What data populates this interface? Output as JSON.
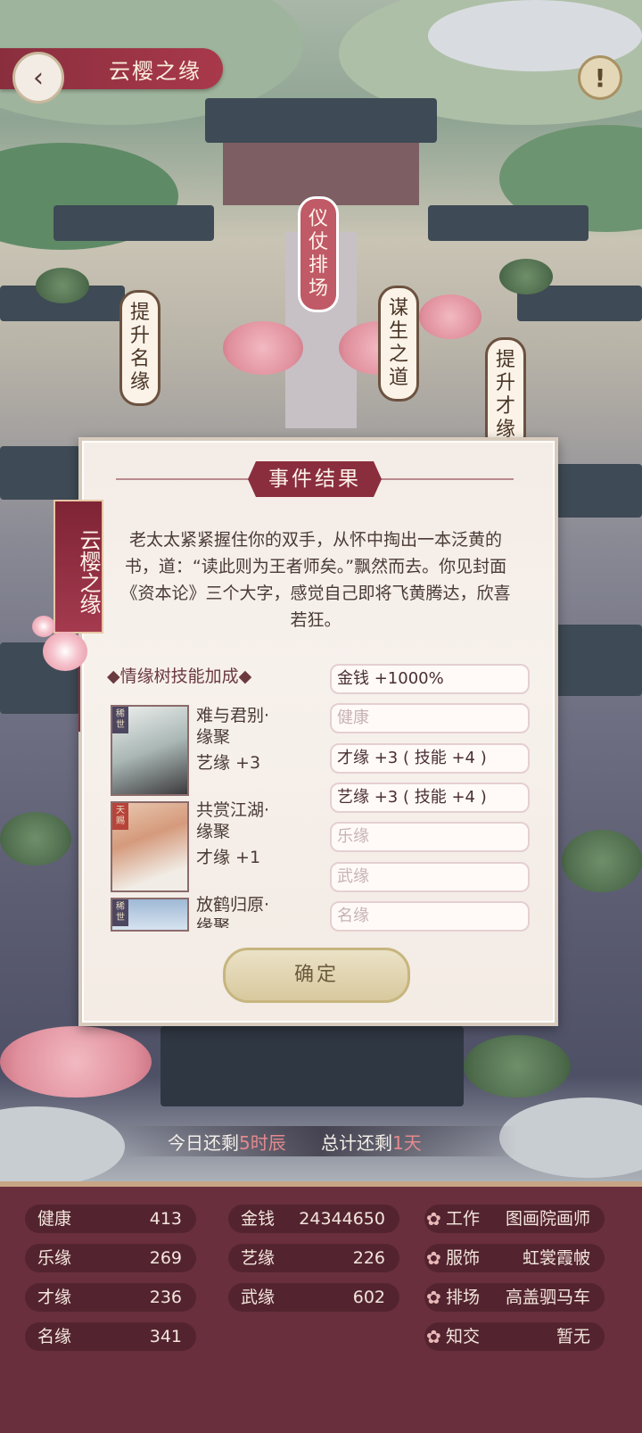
{
  "header": {
    "title": "云樱之缘",
    "back_icon": "‹",
    "info_icon": "!"
  },
  "map_labels": {
    "yizhang": "仪仗排场",
    "tisheng_mingyuan": "提升名缘",
    "mousheng": "谋生之道",
    "tisheng_caiyuan": "提升才缘"
  },
  "modal": {
    "title": "事件结果",
    "body": "老太太紧紧握住你的双手，从怀中掏出一本泛黄的书，道：“读此则为王者师矣。”飘然而去。你见封面《资本论》三个大字，感觉自己即将飞黄腾达，欣喜若狂。",
    "ribbon_text": "云樱之缘",
    "section_head": "◆情缘树技能加成◆",
    "cards": [
      {
        "tag": "稀世",
        "name_line1": "难与君别·",
        "name_line2": "缘聚",
        "bonus": "艺缘 +3"
      },
      {
        "tag": "天赐",
        "name_line1": "共赏江湖·",
        "name_line2": "缘聚",
        "bonus": "才缘 +1"
      },
      {
        "tag": "稀世",
        "name_line1": "放鹤归原·",
        "name_line2": "缘聚"
      }
    ],
    "stat_pills": [
      {
        "label": "金钱 +1000%",
        "active": true
      },
      {
        "label": "健康",
        "active": false
      },
      {
        "label": "才缘 +3 ( 技能 +4 )",
        "active": true
      },
      {
        "label": "艺缘 +3 ( 技能 +4 )",
        "active": true
      },
      {
        "label": "乐缘",
        "active": false
      },
      {
        "label": "武缘",
        "active": false
      },
      {
        "label": "名缘",
        "active": false
      }
    ],
    "confirm_label": "确定"
  },
  "time": {
    "prefix": "今日还剩",
    "hours": "5时辰",
    "total_prefix": "总计还剩",
    "days": "1天"
  },
  "stats": {
    "col1": [
      {
        "k": "健康",
        "v": "413"
      },
      {
        "k": "乐缘",
        "v": "269"
      },
      {
        "k": "才缘",
        "v": "236"
      },
      {
        "k": "名缘",
        "v": "341"
      }
    ],
    "col2": [
      {
        "k": "金钱",
        "v": "24344650"
      },
      {
        "k": "艺缘",
        "v": "226"
      },
      {
        "k": "武缘",
        "v": "602"
      }
    ],
    "col3": [
      {
        "k": "工作",
        "v": "图画院画师"
      },
      {
        "k": "服饰",
        "v": "虹裳霞帔"
      },
      {
        "k": "排场",
        "v": "高盖驷马车"
      },
      {
        "k": "知交",
        "v": "暂无"
      }
    ],
    "flower_icon": "✿"
  },
  "colors": {
    "accent": "#8a2e3e",
    "panel": "#6a2f3c",
    "pill": "#53242f",
    "highlight": "#e38a8e"
  }
}
